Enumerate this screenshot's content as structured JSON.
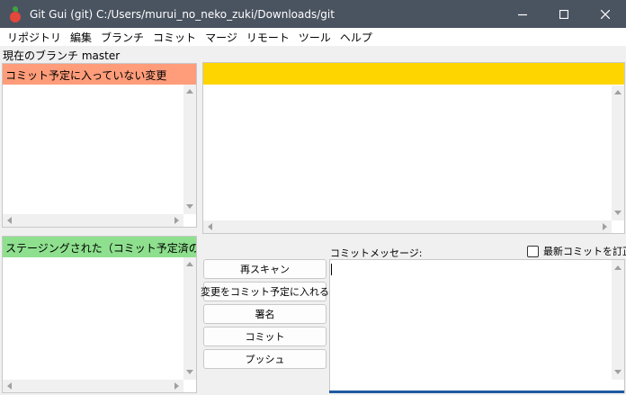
{
  "window": {
    "title": "Git Gui (git) C:/Users/murui_no_neko_zuki/Downloads/git"
  },
  "menu": [
    {
      "label": "リポジトリ"
    },
    {
      "label": "編集"
    },
    {
      "label": "ブランチ"
    },
    {
      "label": "コミット"
    },
    {
      "label": "マージ"
    },
    {
      "label": "リモート"
    },
    {
      "label": "ツール"
    },
    {
      "label": "ヘルプ"
    }
  ],
  "branch": {
    "text": "現在のブランチ master"
  },
  "unstaged": {
    "header": "コミット予定に入っていない変更",
    "color": "#ff9c7a"
  },
  "staged": {
    "header": "ステージングされた（コミット予定済の）変更",
    "color": "#8ee08e"
  },
  "diff": {
    "header_color": "#ffd500"
  },
  "actions": [
    {
      "label": "再スキャン"
    },
    {
      "label": "変更をコミット予定に入れる"
    },
    {
      "label": "署名"
    },
    {
      "label": "コミット"
    },
    {
      "label": "プッシュ"
    }
  ],
  "commit": {
    "label": "コミットメッセージ:",
    "amend_label": "最新コミットを訂正",
    "amend_checked": false,
    "message": ""
  }
}
